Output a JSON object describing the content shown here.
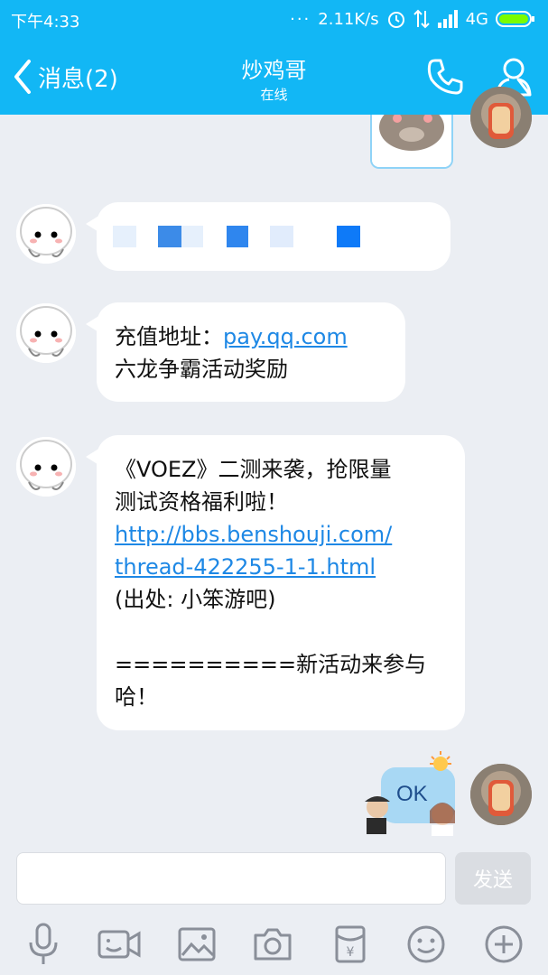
{
  "status_bar": {
    "time": "下午4:33",
    "network_speed": "2.11K/s",
    "network_type": "4G"
  },
  "nav": {
    "back_label": "消息(2)",
    "contact_name": "炒鸡哥",
    "contact_status": "在线"
  },
  "messages": {
    "m2": {
      "prefix": "充值地址：",
      "link": "pay.qq.com",
      "line2": "六龙争霸活动奖励"
    },
    "m3": {
      "line1": "《VOEZ》二测来袭，抢限量",
      "line2": "测试资格福利啦！",
      "link1": "http://bbs.benshouji.com/",
      "link2": "thread-422255-1-1.html",
      "line3": "(出处: 小笨游吧)",
      "line4": "==========新活动来参与",
      "line5": "哈！"
    },
    "sticker_text": "OK"
  },
  "input": {
    "value": "",
    "send_label": "发送"
  },
  "colors": {
    "accent": "#12B7F5",
    "link": "#1E88E5",
    "chat_bg": "#EBEEF3"
  }
}
